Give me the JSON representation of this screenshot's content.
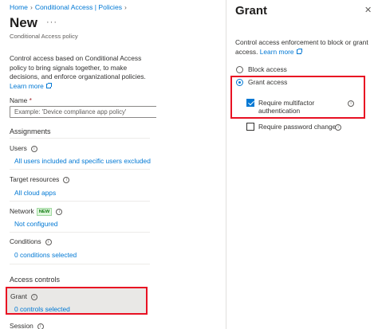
{
  "breadcrumb": {
    "home": "Home",
    "policies": "Conditional Access | Policies"
  },
  "page": {
    "title": "New",
    "subtitle": "Conditional Access policy",
    "description": "Control access based on Conditional Access policy to bring signals together, to make decisions, and enforce organizational policies.",
    "learn_more": "Learn more"
  },
  "name_field": {
    "label": "Name",
    "required_mark": "*",
    "placeholder": "Example: 'Device compliance app policy'"
  },
  "assignments": {
    "title": "Assignments",
    "users": {
      "label": "Users",
      "value": "All users included and specific users excluded"
    },
    "target_resources": {
      "label": "Target resources",
      "value": "All cloud apps"
    },
    "network": {
      "label": "Network",
      "badge": "NEW",
      "value": "Not configured"
    },
    "conditions": {
      "label": "Conditions",
      "value": "0 conditions selected"
    }
  },
  "access_controls": {
    "title": "Access controls",
    "grant": {
      "label": "Grant",
      "value": "0 controls selected"
    },
    "session": {
      "label": "Session"
    }
  },
  "grant_panel": {
    "title": "Grant",
    "close_glyph": "✕",
    "description": "Control access enforcement to block or grant access.",
    "learn_more": "Learn more",
    "options": [
      {
        "label": "Block access",
        "selected": false
      },
      {
        "label": "Grant access",
        "selected": true
      }
    ],
    "controls": [
      {
        "label_line1": "Require multifactor",
        "label_line2": "authentication",
        "checked": true
      },
      {
        "label_line1": "Require password change",
        "checked": false
      }
    ]
  },
  "colors": {
    "accent": "#0078d4",
    "highlight_border": "#e81123",
    "new_badge": "#107c10"
  }
}
